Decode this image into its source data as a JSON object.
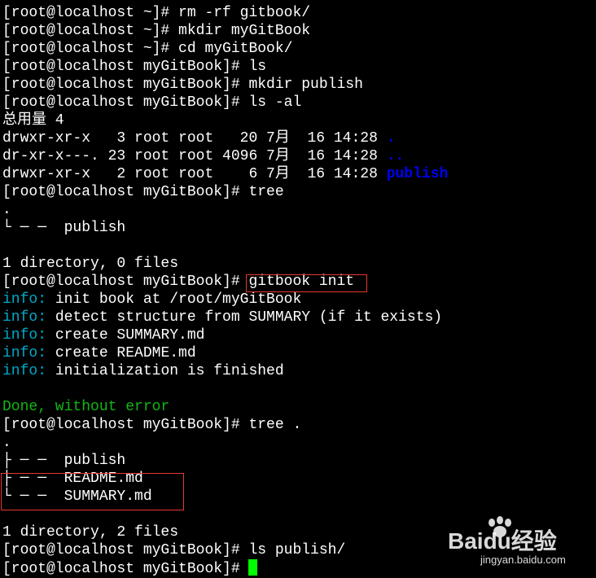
{
  "terminal": {
    "top_cut_line": "[root@localhost ~]# rm -rf gitbook/",
    "lines": [
      [
        [
          "[root@localhost ~]# rm -rf gitbook/",
          "w"
        ]
      ],
      [
        [
          "[root@localhost ~]# mkdir myGitBook",
          "w"
        ]
      ],
      [
        [
          "[root@localhost ~]# cd myGitBook/",
          "w"
        ]
      ],
      [
        [
          "[root@localhost myGitBook]# ls",
          "w"
        ]
      ],
      [
        [
          "[root@localhost myGitBook]# mkdir publish",
          "w"
        ]
      ],
      [
        [
          "[root@localhost myGitBook]# ls -al",
          "w"
        ]
      ],
      [
        [
          "总用量 4",
          "w"
        ]
      ],
      [
        [
          "drwxr-xr-x   3 root root   20 7月  16 14:28 ",
          "w"
        ],
        [
          ".",
          "b"
        ]
      ],
      [
        [
          "dr-xr-x---. 23 root root 4096 7月  16 14:28 ",
          "w"
        ],
        [
          "..",
          "b"
        ]
      ],
      [
        [
          "drwxr-xr-x   2 root root    6 7月  16 14:28 ",
          "w"
        ],
        [
          "publish",
          "b"
        ]
      ],
      [
        [
          "[root@localhost myGitBook]# tree",
          "w"
        ]
      ],
      [
        [
          ".",
          "w"
        ]
      ],
      [
        [
          "└ ─ ─  publish",
          "w"
        ]
      ],
      [
        [
          "",
          "w"
        ]
      ],
      [
        [
          "1 directory, 0 files",
          "w"
        ]
      ],
      [
        [
          "[root@localhost myGitBook]# gitbook init",
          "w"
        ]
      ],
      [
        [
          "info:",
          "c"
        ],
        [
          " init book at /root/myGitBook",
          "w"
        ]
      ],
      [
        [
          "info:",
          "c"
        ],
        [
          " detect structure from SUMMARY (if it exists)",
          "w"
        ]
      ],
      [
        [
          "info:",
          "c"
        ],
        [
          " create SUMMARY.md",
          "w"
        ]
      ],
      [
        [
          "info:",
          "c"
        ],
        [
          " create README.md",
          "w"
        ]
      ],
      [
        [
          "info:",
          "c"
        ],
        [
          " initialization is finished",
          "w"
        ]
      ],
      [
        [
          "",
          "w"
        ]
      ],
      [
        [
          "Done, without error",
          "g"
        ]
      ],
      [
        [
          "[root@localhost myGitBook]# tree .",
          "w"
        ]
      ],
      [
        [
          ".",
          "w"
        ]
      ],
      [
        [
          "├ ─ ─  publish",
          "w"
        ]
      ],
      [
        [
          "├ ─ ─  README.md",
          "w"
        ]
      ],
      [
        [
          "└ ─ ─  SUMMARY.md",
          "w"
        ]
      ],
      [
        [
          "",
          "w"
        ]
      ],
      [
        [
          "1 directory, 2 files",
          "w"
        ]
      ],
      [
        [
          "[root@localhost myGitBook]# ls publish/",
          "w"
        ]
      ],
      [
        [
          "[root@localhost myGitBook]# ",
          "w"
        ]
      ]
    ]
  },
  "colors": {
    "background": "#000000",
    "text": "#ffffff",
    "directory": "#0000ee",
    "info": "#00a8c8",
    "done": "#11b811",
    "cursor": "#00ff00",
    "highlight_box": "#e53935"
  },
  "watermark": {
    "logo_text": "Baidu经验",
    "url": "jingyan.baidu.com"
  }
}
